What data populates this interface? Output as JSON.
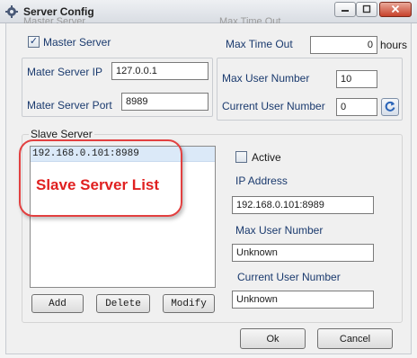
{
  "window": {
    "title": "Server Config",
    "ghost_title": "Master Server",
    "ghost_max_time": "Max Time Out"
  },
  "master": {
    "checkbox_label": "Master Server",
    "checked": true,
    "check_mark": "✓",
    "ip_label": "Mater Server IP",
    "ip_value": "127.0.0.1",
    "port_label": "Mater Server Port",
    "port_value": "8989",
    "max_time_label": "Max Time Out",
    "max_time_value": "0",
    "max_time_unit": "hours",
    "max_user_label": "Max User Number",
    "max_user_value": "10",
    "current_user_label": "Current User Number",
    "current_user_value": "0"
  },
  "slave": {
    "group_title": "Slave Server",
    "list_items": [
      "192.168.0.101:8989"
    ],
    "active_label": "Active",
    "ip_label": "IP Address",
    "ip_value": "192.168.0.101:8989",
    "max_user_label": "Max User Number",
    "max_user_value": "Unknown",
    "current_user_label": "Current User Number",
    "current_user_value": "Unknown",
    "add_label": "Add",
    "delete_label": "Delete",
    "modify_label": "Modify"
  },
  "annotation": {
    "text": "Slave Server List",
    "color": "#e02020"
  },
  "footer": {
    "ok_label": "Ok",
    "cancel_label": "Cancel"
  },
  "icons": {
    "app": "gear-icon",
    "minimize": "minimize-icon",
    "maximize": "maximize-icon",
    "close": "close-icon",
    "refresh": "refresh-icon"
  }
}
